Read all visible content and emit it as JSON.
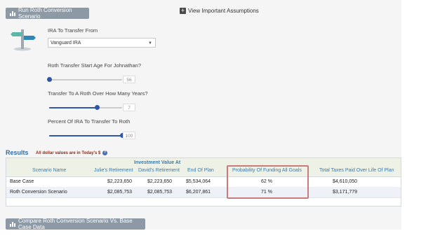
{
  "toolbar": {
    "run_label": "Run Roth Conversion Scenario",
    "assumptions_label": "View Important Assumptions"
  },
  "form": {
    "ira_label": "IRA To Transfer From",
    "ira_value": "Vanguard IRA",
    "start_age_label": "Roth Transfer Start Age For Johnathan?",
    "start_age_value": "56",
    "start_age_level": 0.0,
    "years_label": "Transfer To A Roth Over How Many Years?",
    "years_value": "7",
    "years_level": 0.65,
    "percent_label": "Percent Of IRA To Transfer To Roth",
    "percent_value": "100",
    "percent_level": 1.0
  },
  "results": {
    "title": "Results",
    "note": "All dollar values are in Today's $",
    "group_header": "Investment Value At",
    "columns": [
      "Scenario Name",
      "Julie's Retirement",
      "David's Retirement",
      "End Of Plan",
      "Probability Of Funding All Goals",
      "Total Taxes Paid Over Life Of Plan"
    ],
    "rows": [
      {
        "name": "Base Case",
        "julie": "$2,223,650",
        "david": "$2,223,650",
        "end": "$5,534,064",
        "prob": "62 %",
        "taxes": "$4,610,050"
      },
      {
        "name": "Roth Conversion Scenario",
        "julie": "$2,085,753",
        "david": "$2,085,753",
        "end": "$6,207,861",
        "prob": "71 %",
        "taxes": "$3,171,779"
      }
    ]
  },
  "bottom": {
    "compare_label": "Compare Roth Conversion Scenario Vs. Base Case Data"
  },
  "colors": {
    "accent": "#2e56a8",
    "button": "#8d9aa6",
    "highlight": "#c87b7b",
    "results_title": "#2e6da4"
  }
}
